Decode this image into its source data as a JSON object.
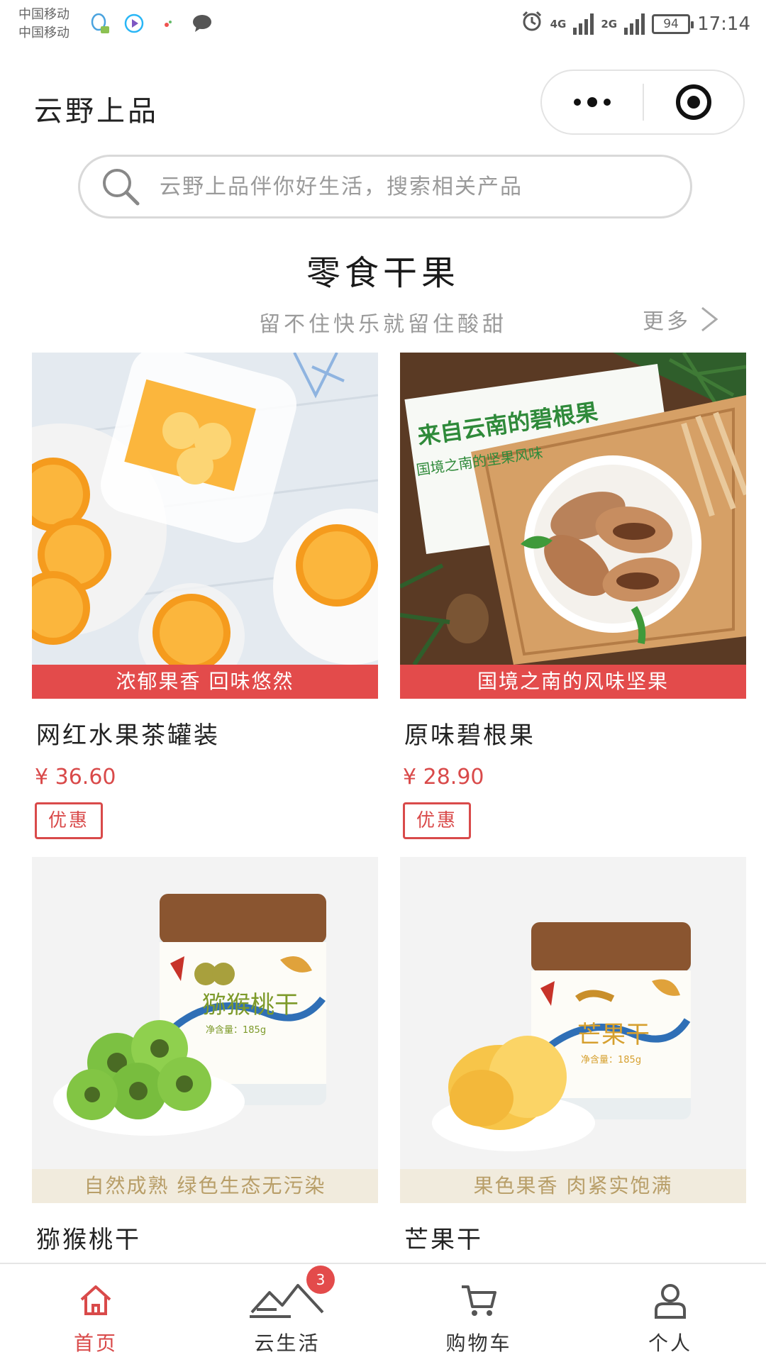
{
  "status_bar": {
    "carrier_1": "中国移动",
    "carrier_2": "中国移动",
    "net_1": "4G",
    "net_2": "2G",
    "battery": "94",
    "time": "17:14"
  },
  "header": {
    "title": "云野上品"
  },
  "search": {
    "placeholder": "云野上品伴你好生活，搜索相关产品"
  },
  "section": {
    "title": "零食干果",
    "subtitle": "留不住快乐就留住酸甜",
    "more": "更多"
  },
  "products": [
    {
      "tagline": "浓郁果香  回味悠然",
      "name": "网红水果茶罐装",
      "price": "¥ 36.60",
      "badge": "优惠"
    },
    {
      "tagline": "国境之南的风味坚果",
      "name": "原味碧根果",
      "price": "¥ 28.90",
      "badge": "优惠",
      "banner_1": "来自云南的碧根果",
      "banner_2": "国境之南的坚果风味"
    },
    {
      "tagline": "自然成熟 绿色生态无污染",
      "name": "猕猴桃干",
      "jar_label": "猕猴桃干",
      "net_weight": "净含量：185g"
    },
    {
      "tagline": "果色果香  肉紧实饱满",
      "name": "芒果干",
      "jar_label": "芒果干",
      "net_weight": "净含量：185g"
    }
  ],
  "tabbar": {
    "items": [
      {
        "label": "首页",
        "icon": "home-icon"
      },
      {
        "label": "云生活",
        "icon": "mountain-icon",
        "badge": "3"
      },
      {
        "label": "购物车",
        "icon": "cart-icon"
      },
      {
        "label": "个人",
        "icon": "person-icon"
      }
    ]
  },
  "colors": {
    "accent_red": "#e34b4b",
    "price_red": "#d94a4a",
    "beige": "#f1ebdd"
  }
}
